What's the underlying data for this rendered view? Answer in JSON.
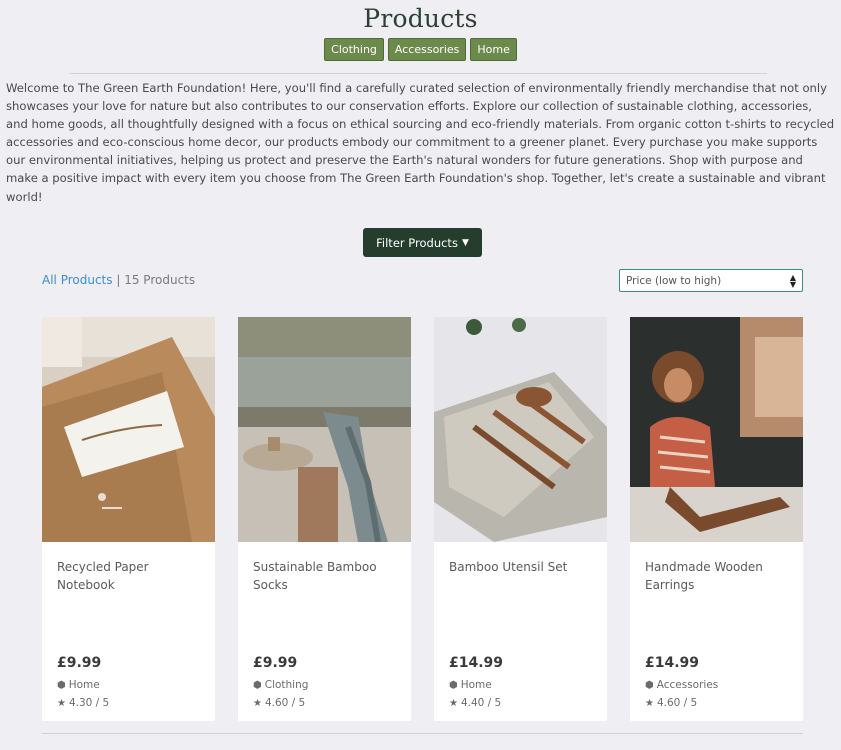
{
  "header": {
    "title": "Products"
  },
  "categories": [
    {
      "label": "Clothing"
    },
    {
      "label": "Accessories"
    },
    {
      "label": "Home"
    }
  ],
  "intro": "Welcome to The Green Earth Foundation! Here, you'll find a carefully curated selection of environmentally friendly merchandise that not only showcases your love for nature but also contributes to our conservation efforts. Explore our collection of sustainable clothing, accessories, and home goods, all thoughtfully designed with a focus on ethical sourcing and eco-friendly materials. From organic cotton t-shirts to recycled accessories and eco-conscious home decor, our products embody our commitment to a greener planet. Every purchase you make supports our environmental initiatives, helping us protect and preserve the Earth's natural wonders for future generations. Shop with purpose and make a positive impact with every item you choose from The Green Earth Foundation's shop. Together, let's create a sustainable and vibrant world!",
  "filter": {
    "label": "Filter Products"
  },
  "listing": {
    "all_label": "All Products",
    "separator": "|",
    "count_label": "15 Products",
    "sort_value": "Price (low to high)"
  },
  "products": [
    {
      "name": "Recycled Paper Notebook",
      "price": "£9.99",
      "category": "Home",
      "rating": "4.30 / 5"
    },
    {
      "name": "Sustainable Bamboo Socks",
      "price": "£9.99",
      "category": "Clothing",
      "rating": "4.60 / 5"
    },
    {
      "name": "Bamboo Utensil Set",
      "price": "£14.99",
      "category": "Home",
      "rating": "4.40 / 5"
    },
    {
      "name": "Handmade Wooden Earrings",
      "price": "£14.99",
      "category": "Accessories",
      "rating": "4.60 / 5"
    }
  ],
  "icons": {
    "tag": "tag-icon",
    "star": "star-icon",
    "caret": "caret-down-icon"
  },
  "colors": {
    "accent_green": "#6b8a4c",
    "dark_green": "#243d2c",
    "link_blue": "#3a8fd6",
    "background": "#efeef3"
  }
}
